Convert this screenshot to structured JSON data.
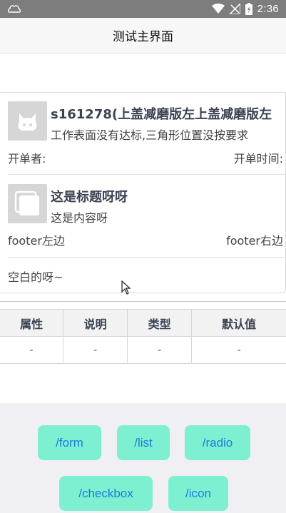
{
  "statusbar": {
    "time": "2:36"
  },
  "navbar": {
    "title": "测试主界面"
  },
  "list": {
    "items": [
      {
        "title": "s161278(上盖减磨版左上盖减磨版左",
        "desc": "工作表面没有达标,三角形位置没按要求",
        "footer_left": "开单者:",
        "footer_right": "开单时间:",
        "thumb_icon": "github-cat-icon"
      },
      {
        "title": "这是标题呀呀",
        "desc": "这是内容呀",
        "footer_left": "footer左边",
        "footer_right": "footer右边",
        "thumb_icon": "stacked-squares-icon"
      }
    ],
    "blank_text": "空白的呀~"
  },
  "table": {
    "headers": [
      "属性",
      "说明",
      "类型",
      "默认值"
    ],
    "rows": [
      [
        "-",
        "-",
        "-",
        "-"
      ]
    ]
  },
  "buttons": {
    "form": "/form",
    "list": "/list",
    "radio": "/radio",
    "checkbox": "/checkbox",
    "icon": "/icon"
  },
  "colors": {
    "statusbar": "#7d7d7d",
    "button_bg": "#7ef0d2",
    "button_text": "#1e7ad6",
    "button_area_bg": "#efeff4"
  }
}
